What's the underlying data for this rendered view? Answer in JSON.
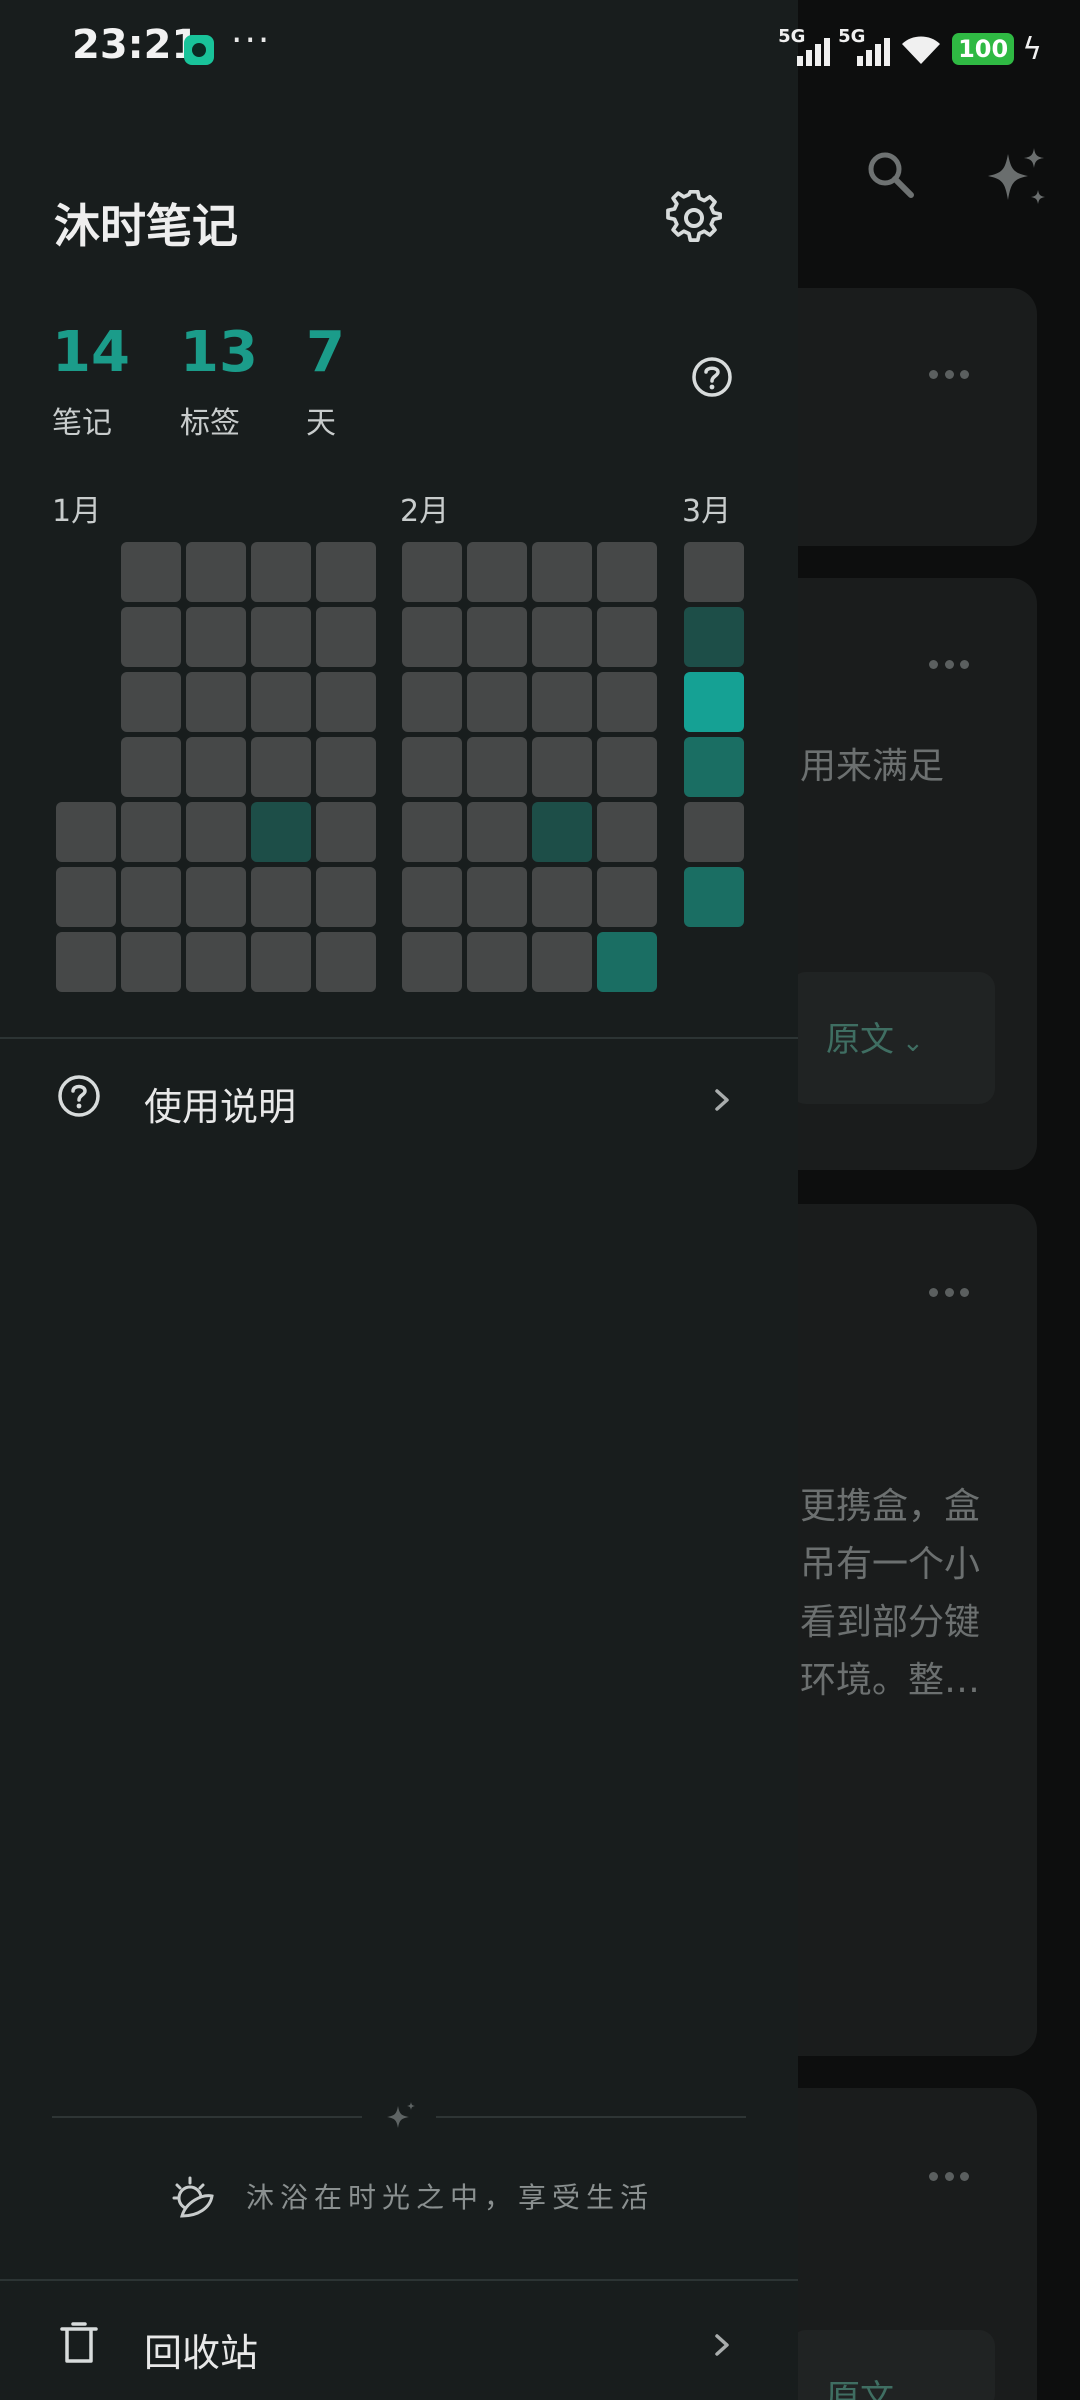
{
  "status_bar": {
    "time": "23:21",
    "more": "···",
    "signal1": "5G",
    "signal2": "5G",
    "battery": "100"
  },
  "drawer": {
    "title": "沐时笔记",
    "stats": [
      {
        "value": "14",
        "label": "笔记"
      },
      {
        "value": "13",
        "label": "标签"
      },
      {
        "value": "7",
        "label": "天"
      }
    ],
    "heatmap": {
      "months": [
        "1月",
        "2月",
        "3月"
      ],
      "active_colors": {
        "level1": "#1d4e48",
        "level2": "#1a6e63",
        "level3": "#15a194"
      }
    },
    "menu_items": [
      {
        "label": "使用说明",
        "icon": "help-circle-icon"
      }
    ],
    "footer_quote": "沐浴在时光之中，享受生活",
    "trash_label": "回收站"
  },
  "background": {
    "card2_text": "用来满足",
    "card2_source": "原文",
    "card3_lines": [
      "更携盒，盒",
      "吊有一个小",
      "看到部分键",
      "环境。整…"
    ],
    "card4_source": "原文"
  }
}
